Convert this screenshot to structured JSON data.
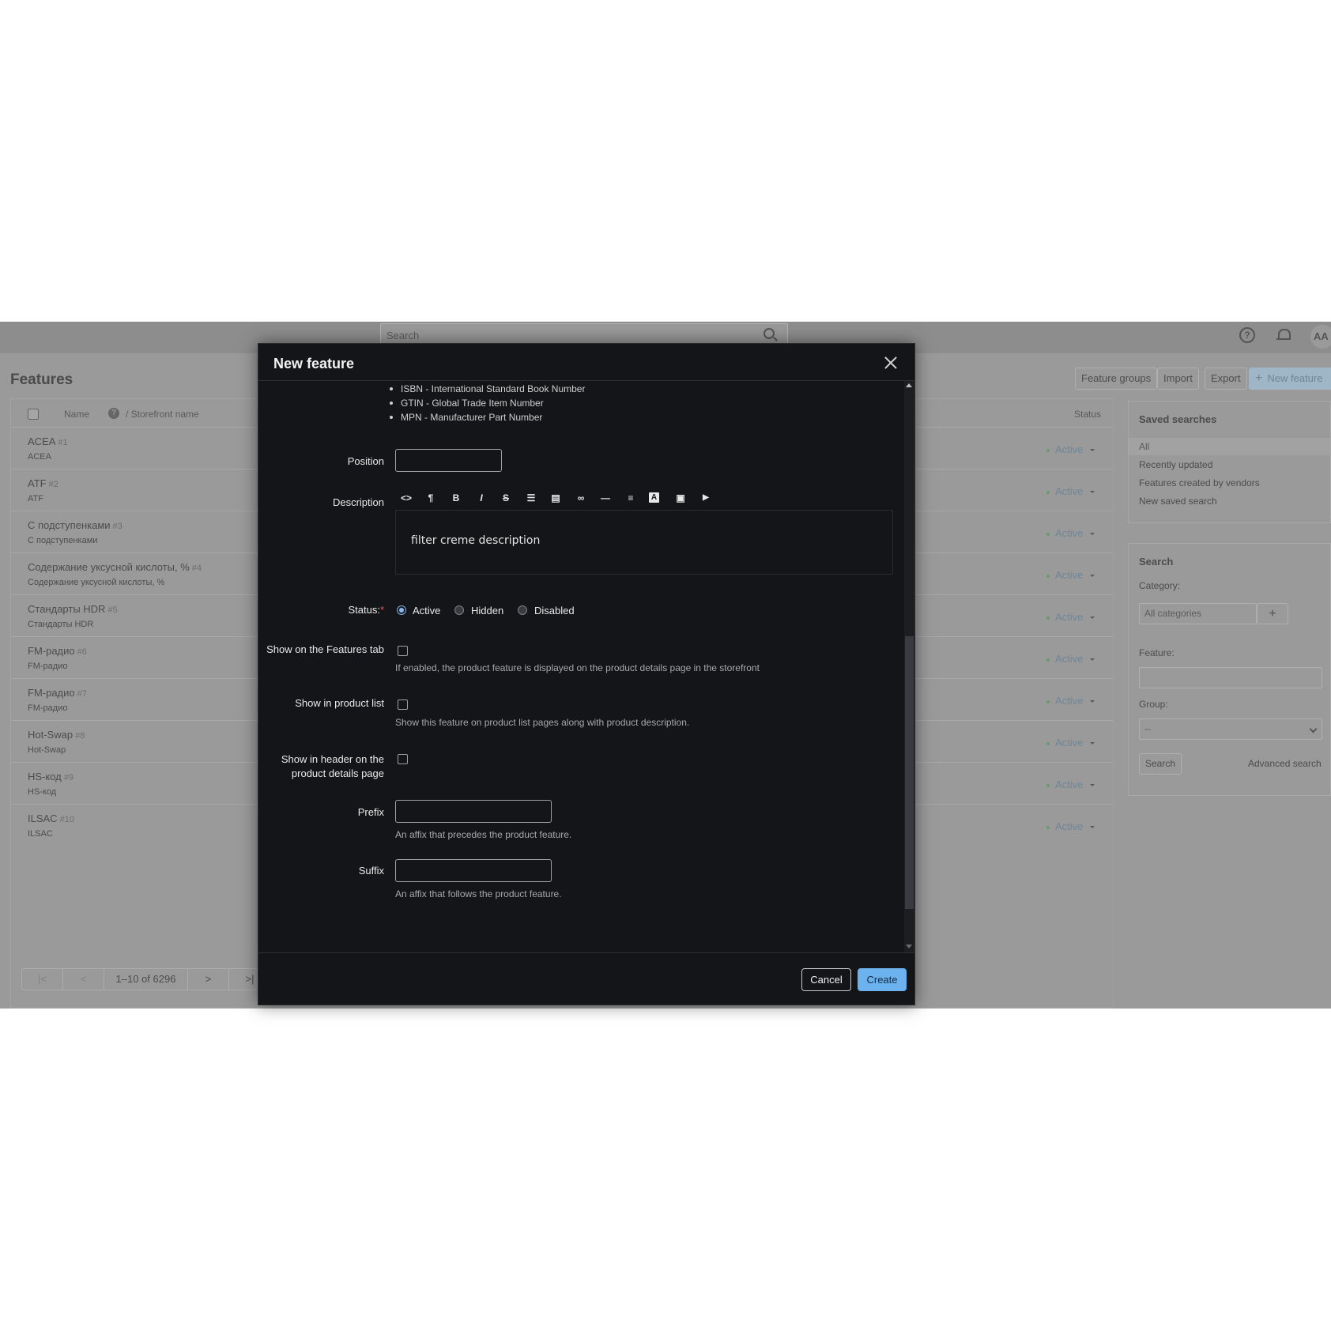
{
  "topbar": {
    "search_placeholder": "Search",
    "avatar_initials": "AA"
  },
  "page": {
    "title": "Features",
    "buttons": {
      "feature_groups": "Feature groups",
      "import": "Import",
      "export": "Export",
      "new_feature": "New feature"
    }
  },
  "list": {
    "header": {
      "name": "Name",
      "help": "?",
      "storefront": "/  Storefront name",
      "status": "Status"
    },
    "rows": [
      {
        "name": "ACEA",
        "id": "#1",
        "storefront": "ACEA",
        "status": "Active"
      },
      {
        "name": "ATF",
        "id": "#2",
        "storefront": "ATF",
        "status": "Active"
      },
      {
        "name": "С подступенками",
        "id": "#3",
        "storefront": "С подступенками",
        "status": "Active"
      },
      {
        "name": "Содержание уксусной кислоты, %",
        "id": "#4",
        "storefront": "Содержание уксусной кислоты, %",
        "status": "Active"
      },
      {
        "name": "Стандарты HDR",
        "id": "#5",
        "storefront": "Стандарты HDR",
        "status": "Active"
      },
      {
        "name": "FM-радио",
        "id": "#6",
        "storefront": "FM-радио",
        "status": "Active"
      },
      {
        "name": "FM-радио",
        "id": "#7",
        "storefront": "FM-радио",
        "status": "Active"
      },
      {
        "name": "Hot-Swap",
        "id": "#8",
        "storefront": "Hot-Swap",
        "status": "Active"
      },
      {
        "name": "HS-код",
        "id": "#9",
        "storefront": "HS-код",
        "status": "Active"
      },
      {
        "name": "ILSAC",
        "id": "#10",
        "storefront": "ILSAC",
        "status": "Active"
      }
    ],
    "pager": {
      "first": "|<",
      "prev": "<",
      "range": "1–10 of 6296",
      "next": ">",
      "last": ">|"
    }
  },
  "saved_searches": {
    "title": "Saved searches",
    "items": [
      "All",
      "Recently updated",
      "Features created by vendors",
      "New saved search"
    ]
  },
  "search_panel": {
    "title": "Search",
    "category_label": "Category:",
    "category_value": "All categories",
    "add_symbol": "+",
    "feature_label": "Feature:",
    "group_label": "Group:",
    "group_value": "--",
    "search_button": "Search",
    "advanced_link": "Advanced search"
  },
  "modal": {
    "title": "New feature",
    "bullets": [
      "ISBN - International Standard Book Number",
      "GTIN - Global Trade Item Number",
      "MPN - Manufacturer Part Number"
    ],
    "position_label": "Position",
    "description_label": "Description",
    "toolbar_icons": [
      "code-view-icon",
      "paragraph-icon",
      "bold-icon",
      "italic-icon",
      "strikethrough-icon",
      "unordered-list-icon",
      "ordered-list-icon",
      "link-icon",
      "horizontal-rule-icon",
      "align-icon",
      "text-color-icon",
      "image-icon",
      "video-icon"
    ],
    "toolbar_glyphs": [
      "<>",
      "¶",
      "B",
      "I",
      "S",
      "☰",
      "▤",
      "∞",
      "—",
      "≡",
      "A",
      "▣",
      "▶"
    ],
    "description_value": "filter creme description",
    "status_label": "Status:",
    "required_mark": "*",
    "status_options": [
      "Active",
      "Hidden",
      "Disabled"
    ],
    "status_selected": "Active",
    "show_features_tab_label": "Show on the Features tab",
    "show_features_tab_hint": "If enabled, the product feature is displayed on the product details page in the storefront",
    "show_product_list_label": "Show in product list",
    "show_product_list_hint": "Show this feature on product list pages along with product description.",
    "show_header_label_line1": "Show in header on the",
    "show_header_label_line2": "product details page",
    "prefix_label": "Prefix",
    "prefix_hint": "An affix that precedes the product feature.",
    "suffix_label": "Suffix",
    "suffix_hint": "An affix that follows the product feature.",
    "cancel": "Cancel",
    "create": "Create"
  }
}
